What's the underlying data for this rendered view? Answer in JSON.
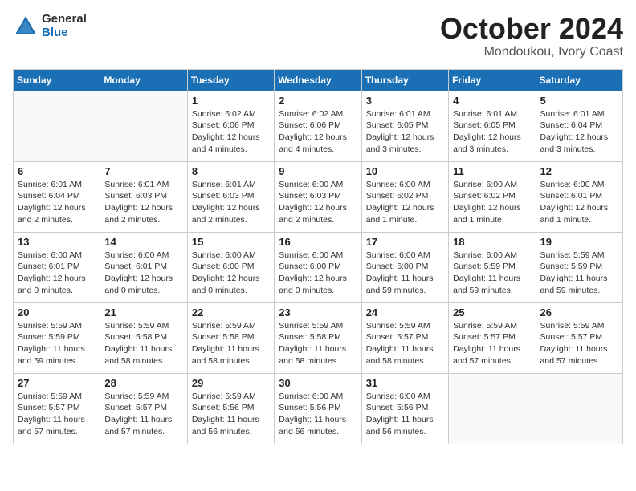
{
  "logo": {
    "general": "General",
    "blue": "Blue"
  },
  "title": "October 2024",
  "location": "Mondoukou, Ivory Coast",
  "days_header": [
    "Sunday",
    "Monday",
    "Tuesday",
    "Wednesday",
    "Thursday",
    "Friday",
    "Saturday"
  ],
  "weeks": [
    [
      {
        "num": "",
        "detail": ""
      },
      {
        "num": "",
        "detail": ""
      },
      {
        "num": "1",
        "detail": "Sunrise: 6:02 AM\nSunset: 6:06 PM\nDaylight: 12 hours and 4 minutes."
      },
      {
        "num": "2",
        "detail": "Sunrise: 6:02 AM\nSunset: 6:06 PM\nDaylight: 12 hours and 4 minutes."
      },
      {
        "num": "3",
        "detail": "Sunrise: 6:01 AM\nSunset: 6:05 PM\nDaylight: 12 hours and 3 minutes."
      },
      {
        "num": "4",
        "detail": "Sunrise: 6:01 AM\nSunset: 6:05 PM\nDaylight: 12 hours and 3 minutes."
      },
      {
        "num": "5",
        "detail": "Sunrise: 6:01 AM\nSunset: 6:04 PM\nDaylight: 12 hours and 3 minutes."
      }
    ],
    [
      {
        "num": "6",
        "detail": "Sunrise: 6:01 AM\nSunset: 6:04 PM\nDaylight: 12 hours and 2 minutes."
      },
      {
        "num": "7",
        "detail": "Sunrise: 6:01 AM\nSunset: 6:03 PM\nDaylight: 12 hours and 2 minutes."
      },
      {
        "num": "8",
        "detail": "Sunrise: 6:01 AM\nSunset: 6:03 PM\nDaylight: 12 hours and 2 minutes."
      },
      {
        "num": "9",
        "detail": "Sunrise: 6:00 AM\nSunset: 6:03 PM\nDaylight: 12 hours and 2 minutes."
      },
      {
        "num": "10",
        "detail": "Sunrise: 6:00 AM\nSunset: 6:02 PM\nDaylight: 12 hours and 1 minute."
      },
      {
        "num": "11",
        "detail": "Sunrise: 6:00 AM\nSunset: 6:02 PM\nDaylight: 12 hours and 1 minute."
      },
      {
        "num": "12",
        "detail": "Sunrise: 6:00 AM\nSunset: 6:01 PM\nDaylight: 12 hours and 1 minute."
      }
    ],
    [
      {
        "num": "13",
        "detail": "Sunrise: 6:00 AM\nSunset: 6:01 PM\nDaylight: 12 hours and 0 minutes."
      },
      {
        "num": "14",
        "detail": "Sunrise: 6:00 AM\nSunset: 6:01 PM\nDaylight: 12 hours and 0 minutes."
      },
      {
        "num": "15",
        "detail": "Sunrise: 6:00 AM\nSunset: 6:00 PM\nDaylight: 12 hours and 0 minutes."
      },
      {
        "num": "16",
        "detail": "Sunrise: 6:00 AM\nSunset: 6:00 PM\nDaylight: 12 hours and 0 minutes."
      },
      {
        "num": "17",
        "detail": "Sunrise: 6:00 AM\nSunset: 6:00 PM\nDaylight: 11 hours and 59 minutes."
      },
      {
        "num": "18",
        "detail": "Sunrise: 6:00 AM\nSunset: 5:59 PM\nDaylight: 11 hours and 59 minutes."
      },
      {
        "num": "19",
        "detail": "Sunrise: 5:59 AM\nSunset: 5:59 PM\nDaylight: 11 hours and 59 minutes."
      }
    ],
    [
      {
        "num": "20",
        "detail": "Sunrise: 5:59 AM\nSunset: 5:59 PM\nDaylight: 11 hours and 59 minutes."
      },
      {
        "num": "21",
        "detail": "Sunrise: 5:59 AM\nSunset: 5:58 PM\nDaylight: 11 hours and 58 minutes."
      },
      {
        "num": "22",
        "detail": "Sunrise: 5:59 AM\nSunset: 5:58 PM\nDaylight: 11 hours and 58 minutes."
      },
      {
        "num": "23",
        "detail": "Sunrise: 5:59 AM\nSunset: 5:58 PM\nDaylight: 11 hours and 58 minutes."
      },
      {
        "num": "24",
        "detail": "Sunrise: 5:59 AM\nSunset: 5:57 PM\nDaylight: 11 hours and 58 minutes."
      },
      {
        "num": "25",
        "detail": "Sunrise: 5:59 AM\nSunset: 5:57 PM\nDaylight: 11 hours and 57 minutes."
      },
      {
        "num": "26",
        "detail": "Sunrise: 5:59 AM\nSunset: 5:57 PM\nDaylight: 11 hours and 57 minutes."
      }
    ],
    [
      {
        "num": "27",
        "detail": "Sunrise: 5:59 AM\nSunset: 5:57 PM\nDaylight: 11 hours and 57 minutes."
      },
      {
        "num": "28",
        "detail": "Sunrise: 5:59 AM\nSunset: 5:57 PM\nDaylight: 11 hours and 57 minutes."
      },
      {
        "num": "29",
        "detail": "Sunrise: 5:59 AM\nSunset: 5:56 PM\nDaylight: 11 hours and 56 minutes."
      },
      {
        "num": "30",
        "detail": "Sunrise: 6:00 AM\nSunset: 5:56 PM\nDaylight: 11 hours and 56 minutes."
      },
      {
        "num": "31",
        "detail": "Sunrise: 6:00 AM\nSunset: 5:56 PM\nDaylight: 11 hours and 56 minutes."
      },
      {
        "num": "",
        "detail": ""
      },
      {
        "num": "",
        "detail": ""
      }
    ]
  ]
}
